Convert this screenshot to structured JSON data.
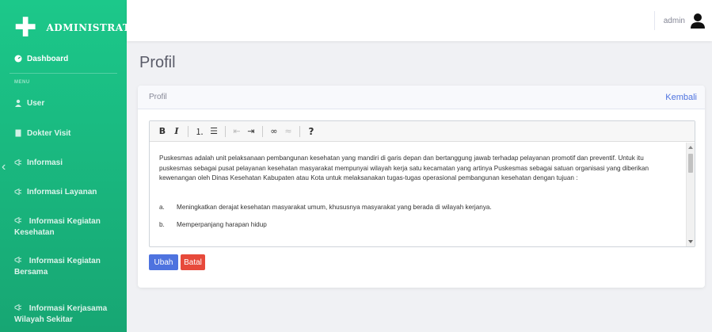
{
  "sidebar": {
    "brand": "ADMINISTRATOR",
    "dashboard": "Dashboard",
    "menu_heading": "MENU",
    "items": [
      {
        "label": "User",
        "icon": "user-icon"
      },
      {
        "label": "Dokter Visit",
        "icon": "file-icon"
      },
      {
        "label": "Informasi",
        "icon": "megaphone-icon"
      },
      {
        "label": "Informasi Layanan",
        "icon": "megaphone-icon"
      },
      {
        "label": "Informasi Kegiatan Kesehatan",
        "icon": "megaphone-icon"
      },
      {
        "label": "Informasi Kegiatan Bersama",
        "icon": "megaphone-icon"
      },
      {
        "label": "Informasi Kerjasama Wilayah Sekitar",
        "icon": "megaphone-icon"
      }
    ]
  },
  "topbar": {
    "user_name": "admin"
  },
  "page": {
    "title": "Profil",
    "card_title": "Profil",
    "back_label": "Kembali"
  },
  "editor": {
    "paragraph": "Puskesmas adalah unit pelaksanaan pembangunan kesehatan yang mandiri di garis depan dan bertanggung jawab terhadap pelayanan promotif dan preventif. Untuk itu puskesmas sebagai pusat pelayanan kesehatan masyarakat mempunyai wilayah kerja satu kecamatan yang artinya Puskesmas sebagai satuan organisasi yang diberikan kewenangan oleh Dinas Kesehatan Kabupaten atau Kota untuk melaksanakan tugas-tugas operasional pembangunan kesehatan dengan tujuan :",
    "list": [
      {
        "num": "a.",
        "text": "Meningkatkan derajat kesehatan masyarakat umum, khususnya masyarakat yang berada di wilayah kerjanya."
      },
      {
        "num": "b.",
        "text": "Memperpanjang harapan hidup"
      }
    ]
  },
  "buttons": {
    "save": "Ubah",
    "cancel": "Batal"
  },
  "colors": {
    "sidebar": "#1cc88a",
    "primary": "#4e73df",
    "danger": "#e74a3b"
  }
}
